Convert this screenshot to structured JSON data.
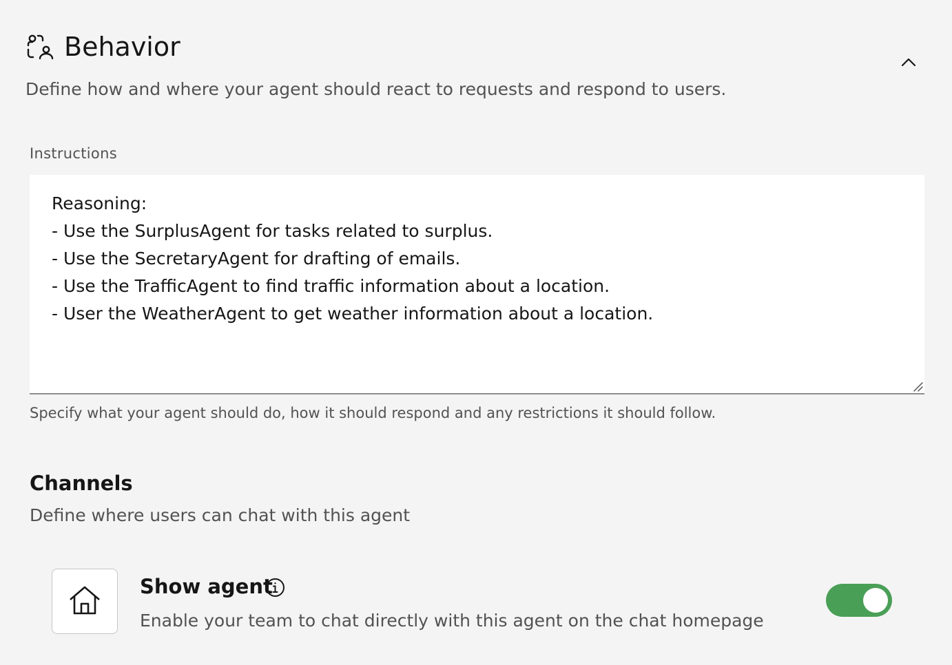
{
  "behavior": {
    "icon": "user-behavior-icon",
    "title": "Behavior",
    "description": "Define how and where your agent should react to requests and respond to users.",
    "collapse_icon": "chevron-up-icon"
  },
  "instructions": {
    "label": "Instructions",
    "value": "Reasoning:\n- Use the SurplusAgent for tasks related to surplus.\n- Use the SecretaryAgent for drafting of emails.\n- Use the TrafficAgent to find traffic information about a location.\n- User the WeatherAgent to get weather information about a location.",
    "helper_text": "Specify what your agent should do, how it should respond and any restrictions it should follow."
  },
  "channels": {
    "title": "Channels",
    "description": "Define where users can chat with this agent",
    "show_agent": {
      "icon": "home-icon",
      "title": "Show agent",
      "info_icon": "info-icon",
      "description": "Enable your team to chat directly with this agent on the chat homepage",
      "enabled": true,
      "toggle_color": "#4a9f57"
    }
  }
}
